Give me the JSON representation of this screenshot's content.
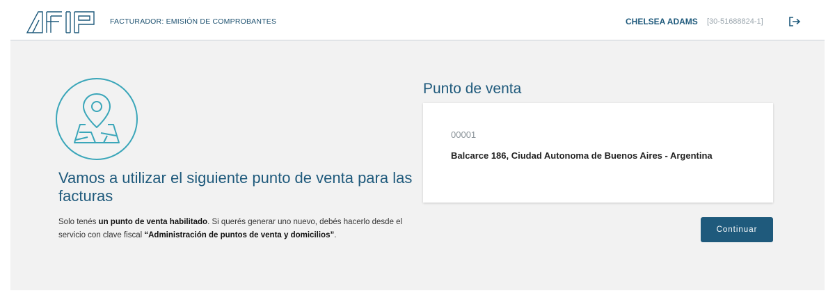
{
  "header": {
    "logo_text": "AFIP",
    "app_title": "FACTURADOR: EMISIÓN DE COMPROBANTES",
    "user_name": "CHELSEA ADAMS",
    "user_cuit": "[30-51688824-1]"
  },
  "intro": {
    "heading": "Vamos a utilizar el siguiente punto de venta para las facturas",
    "text_1": "Solo tenés ",
    "text_bold_1": "un punto de venta habilitado",
    "text_2": ". Si querés generar uno nuevo, debés hacerlo desde el servicio con clave fiscal ",
    "text_bold_2": "“Administración de puntos de venta y domicilios”",
    "text_3": "."
  },
  "punto_venta": {
    "title": "Punto de venta",
    "number": "00001",
    "address": "Balcarce 186, Ciudad Autonoma de Buenos Aires - Argentina"
  },
  "actions": {
    "continue_label": "Continuar"
  },
  "colors": {
    "brand": "#1f5a7c",
    "icon_accent": "#3aa6b9",
    "background": "#f2f2f2"
  }
}
